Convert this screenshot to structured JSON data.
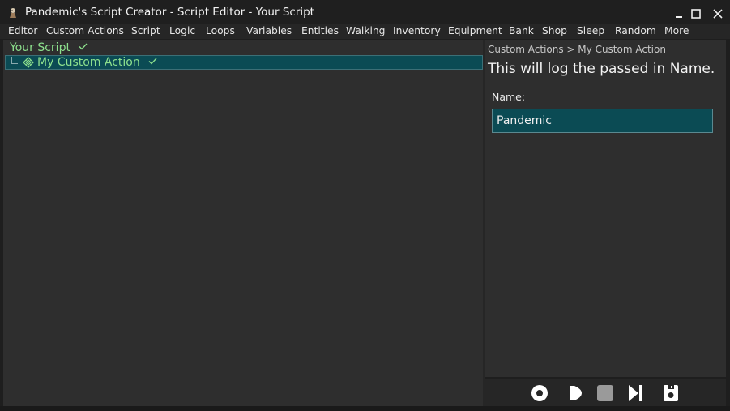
{
  "window": {
    "title": "Pandemic's Script Creator - Script Editor - Your Script",
    "app_icon": "app-logo-icon",
    "controls": [
      "minimize-icon",
      "maximize-icon",
      "close-icon"
    ]
  },
  "menu": {
    "items": [
      "Editor",
      "Custom Actions",
      "Script",
      "Logic",
      "Loops",
      "Variables",
      "Entities",
      "Walking",
      "Inventory",
      "Equipment",
      "Bank",
      "Shop",
      "Sleep",
      "Random",
      "More"
    ]
  },
  "tree": {
    "root_label": "Your Script",
    "root_icon": "checkmark-icon",
    "children": [
      {
        "label": "My Custom Action",
        "icon": "custom-action-icon",
        "status_icon": "checkmark-icon",
        "selected": true
      }
    ]
  },
  "details": {
    "breadcrumb": "Custom Actions > My Custom Action",
    "description": "This will log the passed in Name.",
    "field_label": "Name:",
    "field_value": "Pandemic"
  },
  "controls": {
    "icons": [
      "record-icon",
      "play-icon",
      "stop-icon",
      "step-forward-icon",
      "save-icon"
    ]
  },
  "colors": {
    "accent": "#0b4b54",
    "valid_green": "#8de08d",
    "panel": "#2e2e2e",
    "background": "#1e1e1e"
  }
}
